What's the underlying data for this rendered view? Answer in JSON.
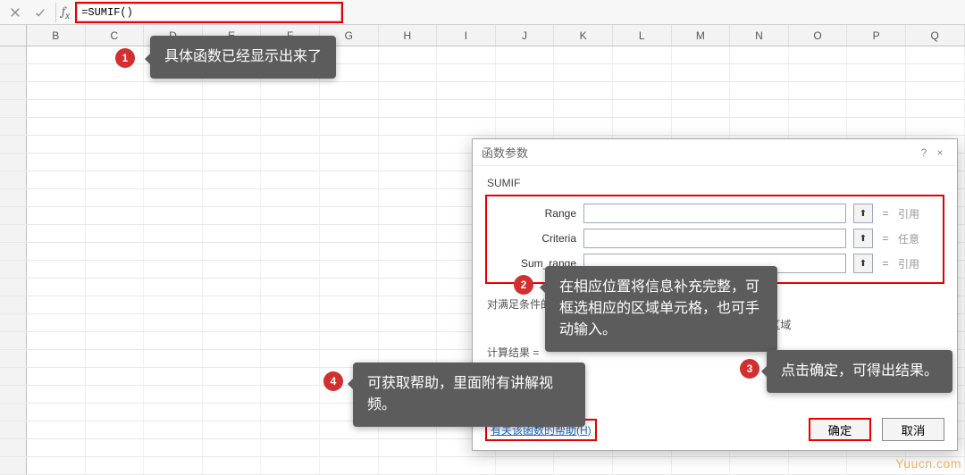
{
  "formula_bar": {
    "value": "=SUMIF()"
  },
  "columns": [
    "B",
    "C",
    "D",
    "E",
    "F",
    "G",
    "H",
    "I",
    "J",
    "K",
    "L",
    "M",
    "N",
    "O",
    "P",
    "Q"
  ],
  "dialog": {
    "title": "函数参数",
    "help_icon": "?",
    "close_icon": "×",
    "function_name": "SUMIF",
    "args": [
      {
        "label": "Range",
        "value": "",
        "placeholder": "",
        "result": "引用"
      },
      {
        "label": "Criteria",
        "value": "",
        "placeholder": "",
        "result": "任意"
      },
      {
        "label": "Sum_range",
        "value": "",
        "placeholder": "",
        "result": "引用"
      }
    ],
    "description": "对满足条件的单元格求和。",
    "arg_hint": "Range  要进行计算的单元格区域",
    "result_label": "计算结果 =",
    "result_value": "",
    "help_link": "有关该函数的帮助(H)",
    "ok": "确定",
    "cancel": "取消"
  },
  "callouts": {
    "c1": "具体函数已经显示出来了",
    "c2": "在相应位置将信息补充完整，可框选相应的区域单元格，也可手动输入。",
    "c3": "点击确定，可得出结果。",
    "c4": "可获取帮助，里面附有讲解视频。"
  },
  "badges": {
    "b1": "1",
    "b2": "2",
    "b3": "3",
    "b4": "4"
  },
  "watermark": "Yuucn.com"
}
